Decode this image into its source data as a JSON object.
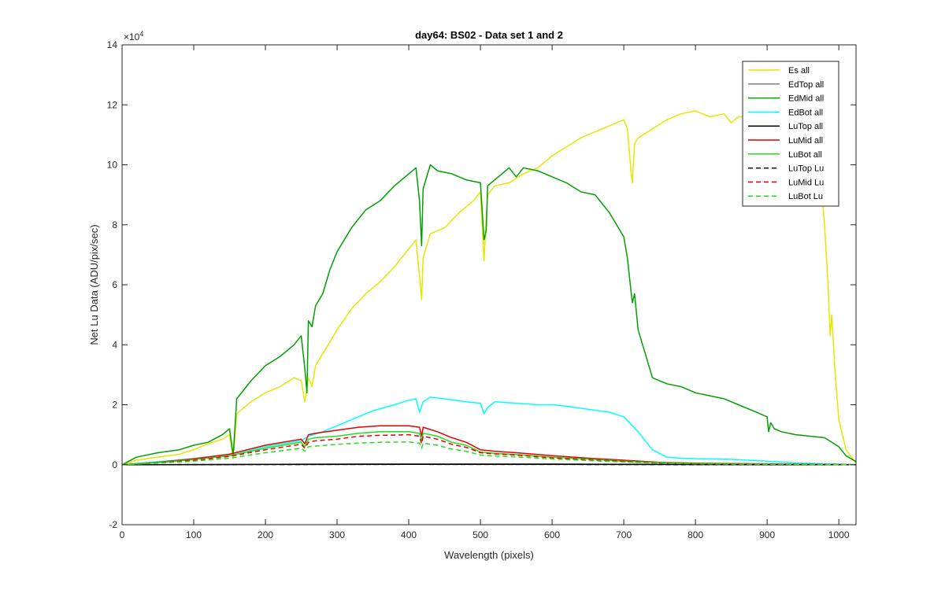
{
  "chart_data": {
    "type": "line",
    "title": "day64: BS02 - Data set 1 and 2",
    "xlabel": "Wavelength (pixels)",
    "ylabel": "Net Lu Data (ADU/pix/sec)",
    "exponent_label": "×10",
    "exponent_power": "4",
    "xlim": [
      0,
      1024
    ],
    "ylim": [
      -20000,
      140000
    ],
    "xticks": [
      0,
      100,
      200,
      300,
      400,
      500,
      600,
      700,
      800,
      900,
      1000
    ],
    "xtick_labels": [
      "0",
      "100",
      "200",
      "300",
      "400",
      "500",
      "600",
      "700",
      "800",
      "900",
      "1000"
    ],
    "yticks": [
      -20000,
      0,
      20000,
      40000,
      60000,
      80000,
      100000,
      120000,
      140000
    ],
    "ytick_labels": [
      "-2",
      "0",
      "2",
      "4",
      "6",
      "8",
      "10",
      "12",
      "14"
    ],
    "grid": false,
    "legend_position": "top-right",
    "series": [
      {
        "name": "Es  all",
        "color": "#e6e600",
        "dash": "solid",
        "x": [
          0,
          20,
          50,
          80,
          100,
          120,
          140,
          150,
          155,
          160,
          180,
          200,
          220,
          240,
          250,
          255,
          260,
          265,
          270,
          280,
          300,
          320,
          340,
          360,
          380,
          400,
          410,
          415,
          418,
          420,
          430,
          450,
          470,
          490,
          500,
          505,
          508,
          510,
          520,
          540,
          560,
          580,
          600,
          620,
          640,
          660,
          680,
          700,
          705,
          710,
          712,
          715,
          720,
          740,
          760,
          780,
          800,
          820,
          840,
          850,
          860,
          880,
          900,
          905,
          910,
          920,
          940,
          960,
          970,
          975,
          980,
          985,
          988,
          990,
          995,
          1000,
          1010,
          1024
        ],
        "y": [
          0,
          1500,
          2500,
          3500,
          5000,
          7000,
          8500,
          10000,
          2000,
          17000,
          21000,
          24000,
          26000,
          29000,
          28000,
          21000,
          29000,
          26000,
          33000,
          37000,
          45000,
          52000,
          57000,
          61000,
          66000,
          72000,
          75000,
          63000,
          55000,
          69000,
          77000,
          79000,
          84000,
          88000,
          91000,
          68000,
          82000,
          90000,
          93000,
          94000,
          97000,
          99000,
          103000,
          106000,
          109000,
          111000,
          113000,
          115000,
          112000,
          98000,
          94000,
          107000,
          109000,
          112000,
          115000,
          117000,
          118000,
          116000,
          117000,
          114000,
          116000,
          116000,
          114000,
          100000,
          108000,
          113000,
          112000,
          108000,
          100000,
          95000,
          80000,
          60000,
          43000,
          50000,
          30000,
          15000,
          5000,
          500
        ]
      },
      {
        "name": "EdTop  all",
        "color": "#808080",
        "dash": "solid",
        "x": [
          0,
          200,
          400,
          600,
          800,
          1024
        ],
        "y": [
          0,
          150,
          300,
          250,
          100,
          0
        ]
      },
      {
        "name": "EdMid  all",
        "color": "#00a000",
        "dash": "solid",
        "x": [
          0,
          20,
          50,
          80,
          100,
          120,
          140,
          150,
          155,
          160,
          180,
          200,
          220,
          240,
          250,
          255,
          258,
          260,
          265,
          270,
          280,
          290,
          300,
          320,
          340,
          360,
          380,
          400,
          410,
          415,
          418,
          420,
          430,
          440,
          460,
          480,
          500,
          505,
          508,
          510,
          520,
          540,
          550,
          560,
          580,
          600,
          620,
          640,
          660,
          680,
          700,
          705,
          710,
          712,
          715,
          720,
          740,
          760,
          780,
          800,
          820,
          840,
          860,
          880,
          900,
          902,
          905,
          910,
          920,
          940,
          960,
          980,
          1000,
          1010,
          1024
        ],
        "y": [
          0,
          2500,
          4000,
          5000,
          6500,
          7500,
          10000,
          12000,
          3000,
          22000,
          28000,
          33000,
          36000,
          40000,
          43000,
          32000,
          24000,
          48000,
          46000,
          53000,
          57000,
          65000,
          71000,
          79000,
          85000,
          88000,
          93000,
          97000,
          99000,
          88000,
          73000,
          92000,
          100000,
          98000,
          97000,
          95000,
          94000,
          75000,
          78000,
          93000,
          95000,
          99000,
          96000,
          99000,
          98000,
          96000,
          94000,
          91000,
          90000,
          84000,
          76000,
          69000,
          58000,
          54000,
          57000,
          45000,
          29000,
          27000,
          26000,
          24000,
          23000,
          22000,
          20000,
          18000,
          16000,
          11000,
          14000,
          12000,
          11000,
          10000,
          9500,
          9000,
          6000,
          3000,
          1000
        ]
      },
      {
        "name": "EdBot  all",
        "color": "#00ffff",
        "dash": "solid",
        "x": [
          0,
          50,
          100,
          150,
          200,
          250,
          260,
          280,
          300,
          320,
          350,
          380,
          400,
          410,
          415,
          420,
          430,
          450,
          480,
          500,
          505,
          510,
          520,
          550,
          580,
          600,
          620,
          650,
          680,
          700,
          720,
          740,
          760,
          780,
          800,
          850,
          900,
          950,
          1000,
          1024
        ],
        "y": [
          0,
          1000,
          2000,
          3000,
          6000,
          8000,
          9500,
          11000,
          13000,
          15000,
          18000,
          20000,
          21500,
          22000,
          17500,
          21000,
          22500,
          22000,
          21000,
          20500,
          17000,
          19000,
          21000,
          20500,
          20000,
          20000,
          19500,
          18500,
          17500,
          16000,
          11000,
          5000,
          2500,
          2200,
          2000,
          1800,
          1200,
          500,
          200,
          0
        ]
      },
      {
        "name": "LuTop  all",
        "color": "#000000",
        "dash": "solid",
        "x": [
          0,
          200,
          400,
          600,
          800,
          1024
        ],
        "y": [
          0,
          80,
          150,
          120,
          60,
          0
        ]
      },
      {
        "name": "LuMid  all",
        "color": "#e60000",
        "dash": "solid",
        "x": [
          0,
          50,
          100,
          150,
          200,
          250,
          255,
          260,
          270,
          300,
          330,
          360,
          400,
          415,
          418,
          420,
          440,
          460,
          480,
          500,
          520,
          550,
          600,
          650,
          700,
          750,
          800,
          850,
          900,
          950,
          1000,
          1024
        ],
        "y": [
          0,
          800,
          2000,
          3500,
          6500,
          8500,
          7000,
          10000,
          10500,
          11500,
          12500,
          13000,
          13000,
          12500,
          9500,
          12500,
          11000,
          9000,
          7500,
          5000,
          4500,
          4000,
          3000,
          2200,
          1500,
          800,
          500,
          400,
          300,
          200,
          100,
          0
        ]
      },
      {
        "name": "LuBot  all",
        "color": "#22dd22",
        "dash": "solid",
        "x": [
          0,
          50,
          100,
          150,
          200,
          250,
          255,
          260,
          270,
          300,
          330,
          360,
          400,
          415,
          418,
          420,
          440,
          460,
          480,
          500,
          520,
          550,
          600,
          650,
          700,
          750,
          800,
          850,
          900,
          950,
          1000,
          1024
        ],
        "y": [
          0,
          700,
          1700,
          3000,
          5500,
          7500,
          6000,
          8500,
          9000,
          9500,
          10500,
          11000,
          11000,
          10500,
          8000,
          10500,
          9500,
          7500,
          6500,
          4200,
          3800,
          3400,
          2500,
          1900,
          1200,
          700,
          400,
          300,
          200,
          150,
          80,
          0
        ]
      },
      {
        "name": "LuTop  Lu",
        "color": "#000000",
        "dash": "dashed",
        "x": [
          0,
          200,
          400,
          600,
          800,
          1024
        ],
        "y": [
          0,
          60,
          120,
          100,
          50,
          0
        ]
      },
      {
        "name": "LuMid  Lu",
        "color": "#e60000",
        "dash": "dashed",
        "x": [
          0,
          50,
          100,
          150,
          200,
          250,
          255,
          260,
          270,
          300,
          330,
          360,
          400,
          415,
          418,
          420,
          440,
          460,
          480,
          500,
          520,
          550,
          600,
          650,
          700,
          750,
          800,
          850,
          900,
          950,
          1000,
          1024
        ],
        "y": [
          0,
          600,
          1500,
          2800,
          5000,
          6800,
          5500,
          7500,
          8000,
          8500,
          9500,
          9800,
          10000,
          9500,
          7000,
          9500,
          8500,
          6800,
          5800,
          4000,
          3600,
          3200,
          2300,
          1700,
          1100,
          600,
          350,
          250,
          200,
          120,
          60,
          0
        ]
      },
      {
        "name": "LuBot  Lu",
        "color": "#22dd22",
        "dash": "dashed",
        "x": [
          0,
          50,
          100,
          150,
          200,
          250,
          255,
          260,
          270,
          300,
          330,
          360,
          400,
          415,
          418,
          420,
          440,
          460,
          480,
          500,
          520,
          550,
          600,
          650,
          700,
          750,
          800,
          850,
          900,
          950,
          1000,
          1024
        ],
        "y": [
          0,
          500,
          1200,
          2200,
          4000,
          5500,
          4500,
          6000,
          6200,
          6800,
          7200,
          7500,
          7600,
          7200,
          5500,
          7200,
          6500,
          5200,
          4500,
          3200,
          2900,
          2600,
          1900,
          1400,
          900,
          500,
          300,
          200,
          150,
          100,
          50,
          0
        ]
      }
    ]
  }
}
